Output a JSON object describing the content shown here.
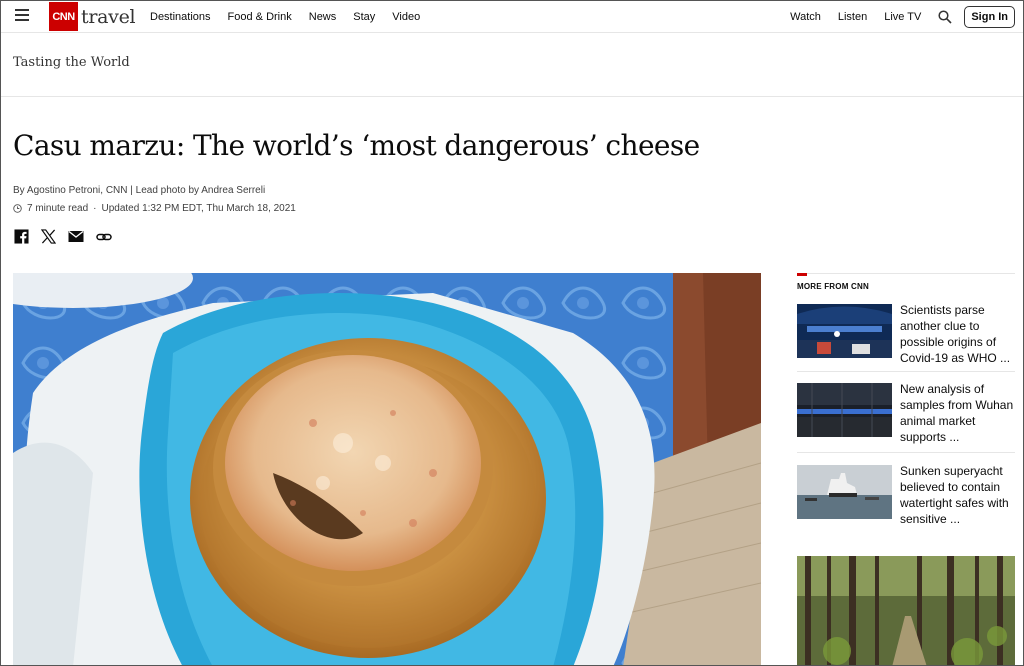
{
  "header": {
    "logo_mark": "CNN",
    "logo_word": "travel",
    "nav": [
      "Destinations",
      "Food & Drink",
      "News",
      "Stay",
      "Video"
    ],
    "right_links": [
      "Watch",
      "Listen",
      "Live TV"
    ],
    "signin_label": "Sign In"
  },
  "section": {
    "title": "Tasting the World"
  },
  "article": {
    "headline": "Casu marzu: The world’s ‘most dangerous’ cheese",
    "byline": "By Agostino Petroni, CNN | Lead photo by Andrea Serreli",
    "read_time": "7 minute read",
    "separator": "·",
    "updated": "Updated 1:32 PM EDT, Thu March 18, 2021"
  },
  "sidebar": {
    "title": "MORE FROM CNN",
    "items": [
      {
        "text": "Scientists parse another clue to possible origins of Covid-19 as WHO ..."
      },
      {
        "text": "New analysis of samples from Wuhan animal market supports ..."
      },
      {
        "text": "Sunken superyacht believed to contain watertight safes with sensitive ..."
      }
    ]
  },
  "icons": [
    "menu-icon",
    "search-icon",
    "clock-icon",
    "facebook-icon",
    "x-icon",
    "email-icon",
    "link-icon"
  ],
  "colors": {
    "brand_red": "#cc0000",
    "text": "#0c0c0c",
    "divider": "#e6e6e6"
  }
}
